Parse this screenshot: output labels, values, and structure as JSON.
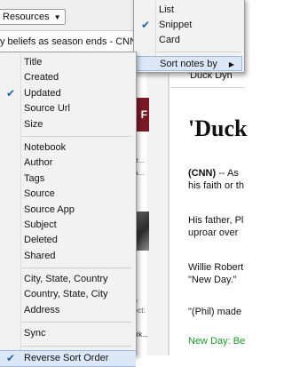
{
  "toolbar": {
    "resources_label": "Resources",
    "caret": "▼"
  },
  "note_list": {
    "selected_title": "y beliefs as season ends - CNN.com",
    "snippets": [
      "ar...",
      "ta...",
      "ie",
      "ject:",
      "ork..."
    ]
  },
  "note_view": {
    "small_title": "'Duck Dyn",
    "heading": "'Duck",
    "paragraphs": {
      "p1_lede": "(CNN)",
      "p1_rest": " -- As",
      "p1_line2": "his faith or th",
      "p2_line1": "His father, Pl",
      "p2_line2": "uproar over",
      "p3_line1": "Willie Robert",
      "p3_line2": "\"New Day.\"",
      "p4_line1": "\"(Phil) made",
      "p5_line1": "New Day: Be"
    }
  },
  "view_menu": {
    "items": [
      {
        "label": "List",
        "checked": false
      },
      {
        "label": "Snippet",
        "checked": true
      },
      {
        "label": "Card",
        "checked": false
      }
    ],
    "sort_label": "Sort notes by",
    "sort_arrow": "▶"
  },
  "sort_menu": {
    "check_glyph": "✔",
    "group1": [
      {
        "label": "Title",
        "checked": false
      },
      {
        "label": "Created",
        "checked": false
      },
      {
        "label": "Updated",
        "checked": true
      },
      {
        "label": "Source Url",
        "checked": false
      },
      {
        "label": "Size",
        "checked": false
      }
    ],
    "group2": [
      {
        "label": "Notebook"
      },
      {
        "label": "Author"
      },
      {
        "label": "Tags"
      },
      {
        "label": "Source"
      },
      {
        "label": "Source App"
      },
      {
        "label": "Subject"
      },
      {
        "label": "Deleted"
      },
      {
        "label": "Shared"
      }
    ],
    "group3": [
      {
        "label": "City, State, Country"
      },
      {
        "label": "Country, State, City"
      },
      {
        "label": "Address"
      }
    ],
    "sync_label": "Sync",
    "reverse_label": "Reverse Sort Order",
    "reverse_checked": true
  },
  "colors": {
    "check": "#1e63b5",
    "highlight": "#dce8f7",
    "menu_bg": "#f2f2f2",
    "green_text": "#1a9a2a"
  }
}
